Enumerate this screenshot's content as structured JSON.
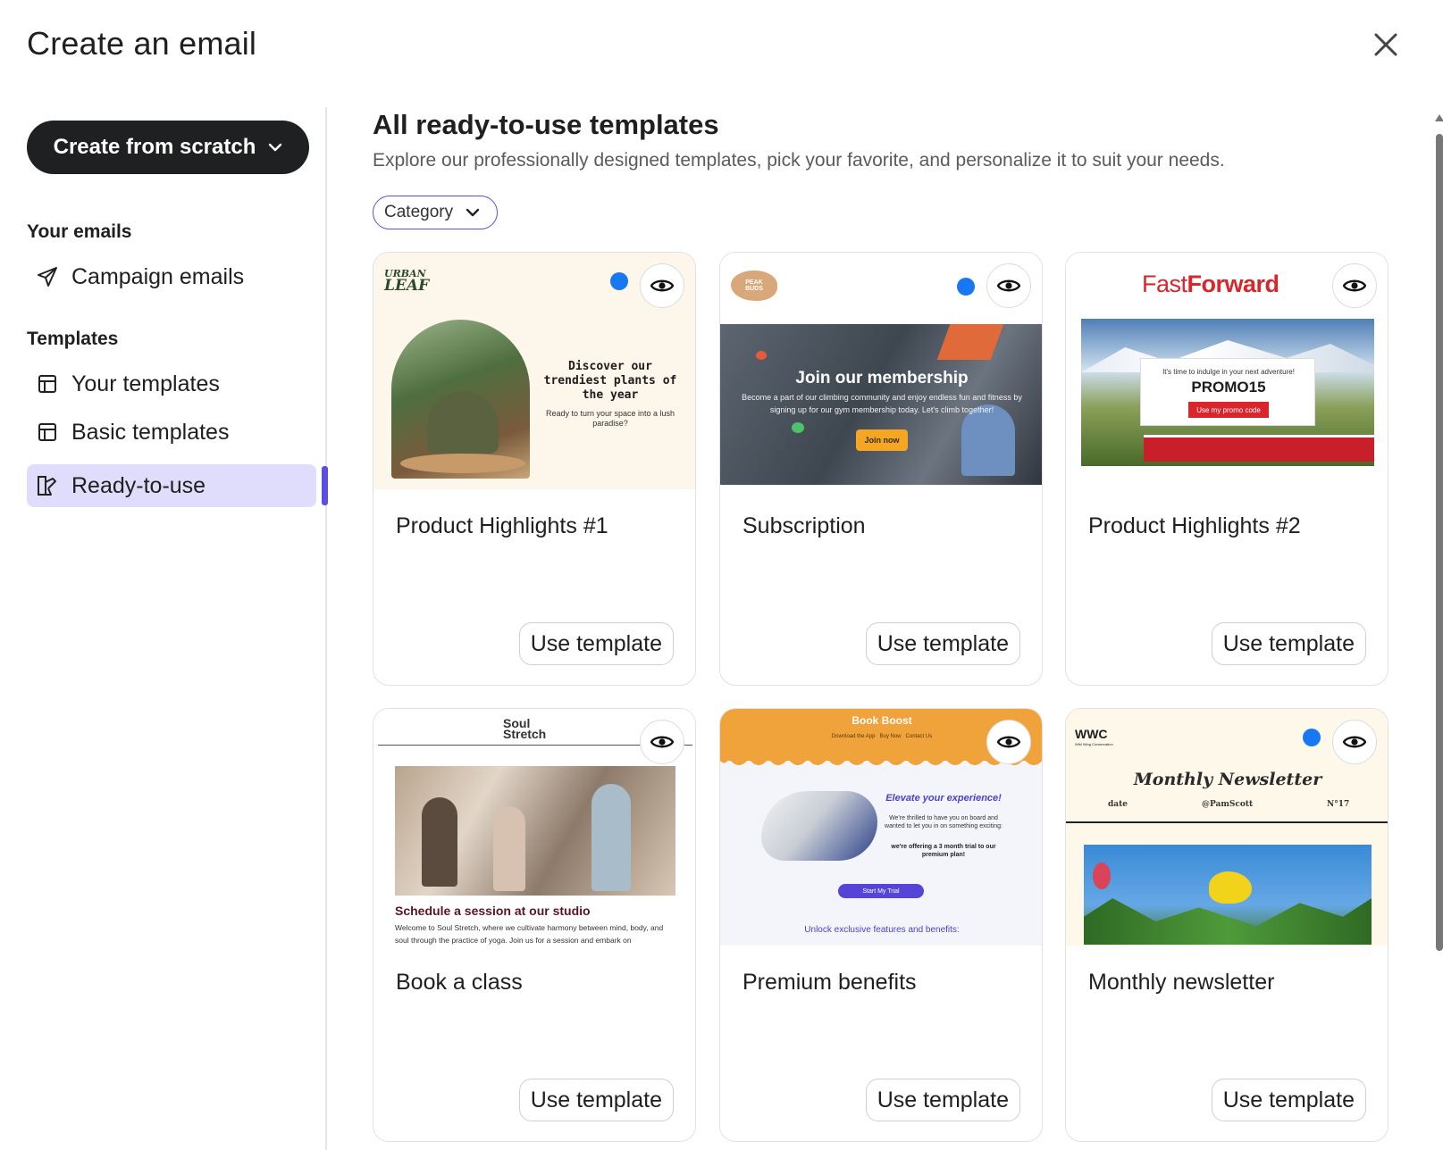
{
  "modal": {
    "title": "Create an email"
  },
  "sidebar": {
    "create_button": "Create from scratch",
    "your_emails_label": "Your emails",
    "campaign_emails": "Campaign emails",
    "templates_label": "Templates",
    "your_templates": "Your templates",
    "basic_templates": "Basic templates",
    "ready_to_use": "Ready-to-use"
  },
  "main": {
    "title": "All ready-to-use templates",
    "subtitle": "Explore our professionally designed templates, pick your favorite, and personalize it to suit your needs.",
    "category_label": "Category",
    "use_label": "Use template"
  },
  "cards": [
    {
      "title": "Product Highlights #1"
    },
    {
      "title": "Subscription"
    },
    {
      "title": "Product Highlights #2"
    },
    {
      "title": "Book a class"
    },
    {
      "title": "Premium benefits"
    },
    {
      "title": "Monthly newsletter"
    }
  ],
  "previews": {
    "urban": {
      "logo_line1": "URBAN",
      "logo_line2": "LEAF",
      "headline": "Discover our trendiest plants of the year",
      "body": "Ready to turn your space into a lush paradise?"
    },
    "peak": {
      "logo": "PEAK BUDS",
      "headline": "Join our membership",
      "body": "Become a part of our climbing community and enjoy endless fun and fitness by signing up for our gym membership today. Let's climb together!",
      "cta": "Join now"
    },
    "fast": {
      "logo_a": "Fast",
      "logo_b": "Forward",
      "line": "It's time to indulge in your next adventure!",
      "code": "PROMO15",
      "cta": "Use my promo code"
    },
    "soul": {
      "logo_line1": "Soul",
      "logo_line2": "Stretch",
      "headline": "Schedule a session at our studio",
      "body": "Welcome to Soul Stretch, where we cultivate harmony between mind, body, and soul through the practice of yoga. Join us for a session and embark on"
    },
    "book": {
      "logo_a": "Book",
      "logo_b": "Boost",
      "nav1": "Download the App",
      "nav2": "Buy Now",
      "nav3": "Contact Us",
      "headline": "Elevate your experience!",
      "body": "We're thrilled to have you on board and wanted to let you in on something exciting:",
      "offer": "we're offering a 3 month trial to our premium plan!",
      "cta": "Start My Trial",
      "footer": "Unlock exclusive features and benefits:"
    },
    "wwc": {
      "logo": "WWC",
      "tagline": "Wild Wing Conservation",
      "headline": "Monthly Newsletter",
      "date": "date",
      "handle": "@PamScott",
      "issue": "N°17"
    }
  },
  "colors": {
    "accent": "#5c4ee5",
    "active_bg": "#e0dcfb",
    "dark_button": "#1f2021"
  }
}
